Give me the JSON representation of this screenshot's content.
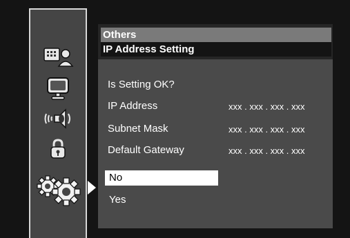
{
  "sidebar": {
    "icons": [
      "display-settings-icon",
      "monitor-icon",
      "audio-speaker-icon",
      "lock-icon",
      "gears-icon"
    ]
  },
  "header": {
    "section": "Others",
    "title": "IP Address Setting"
  },
  "confirm": {
    "question": "Is Setting OK?",
    "rows": [
      {
        "label": "IP Address",
        "value": "xxx . xxx . xxx . xxx"
      },
      {
        "label": "Subnet Mask",
        "value": "xxx . xxx . xxx . xxx"
      },
      {
        "label": "Default Gateway",
        "value": "xxx . xxx . xxx . xxx"
      }
    ],
    "options": [
      "No",
      "Yes"
    ],
    "selected": "No"
  }
}
